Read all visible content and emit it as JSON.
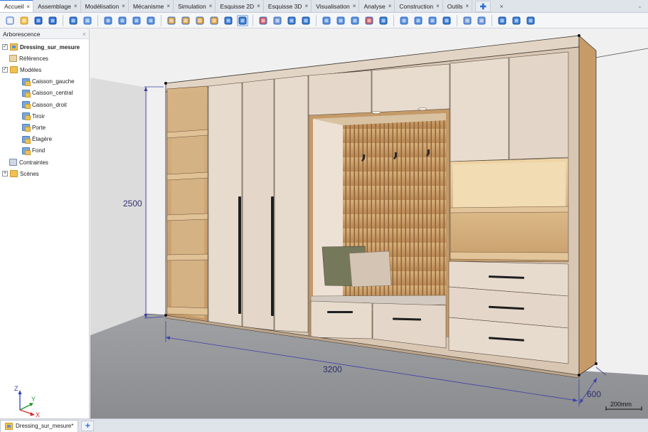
{
  "tabs": [
    {
      "label": "Accueil",
      "active": true
    },
    {
      "label": "Assemblage"
    },
    {
      "label": "Modélisation"
    },
    {
      "label": "Mécanisme"
    },
    {
      "label": "Simulation"
    },
    {
      "label": "Esquisse 2D"
    },
    {
      "label": "Esquisse 3D"
    },
    {
      "label": "Visualisation"
    },
    {
      "label": "Analyse"
    },
    {
      "label": "Construction"
    },
    {
      "label": "Outils"
    }
  ],
  "tab_close_glyph": "×",
  "sidebar": {
    "title": "Arborescence",
    "close_glyph": "×",
    "tree": [
      {
        "label": "Dressing_sur_mesure",
        "level": 0,
        "icon": "assembly-icon",
        "checkbox": true,
        "bold": true
      },
      {
        "label": "Références",
        "level": 1,
        "icon": "references-icon"
      },
      {
        "label": "Modèles",
        "level": 0,
        "icon": "folder-icon",
        "expander": "-",
        "checkbox": true
      },
      {
        "label": "Caisson_gauche",
        "level": 2,
        "icon": "part-icon"
      },
      {
        "label": "Caisson_central",
        "level": 2,
        "icon": "part-icon"
      },
      {
        "label": "Caisson_droit",
        "level": 2,
        "icon": "part-icon"
      },
      {
        "label": "Tiroir",
        "level": 2,
        "icon": "part-icon"
      },
      {
        "label": "Porte",
        "level": 2,
        "icon": "part-icon"
      },
      {
        "label": "Étagère",
        "level": 2,
        "icon": "part-icon"
      },
      {
        "label": "Fond",
        "level": 2,
        "icon": "part-icon"
      },
      {
        "label": "Contraintes",
        "level": 1,
        "icon": "constraints-icon"
      },
      {
        "label": "Scènes",
        "level": 0,
        "icon": "folder-icon",
        "expander": "+"
      }
    ]
  },
  "triad": {
    "x": "X",
    "y": "Y",
    "z": "Z"
  },
  "dimensions": {
    "height": "2500",
    "width": "3200",
    "depth": "600"
  },
  "scale_bar": "200mm",
  "document_tab": {
    "label": "Dressing_sur_mesure*"
  },
  "colors": {
    "accent": "#2d6fd6",
    "dimension_line": "#3b3fa8",
    "cabinet_beige": "#e8dccf",
    "oak": "#c9a274"
  }
}
